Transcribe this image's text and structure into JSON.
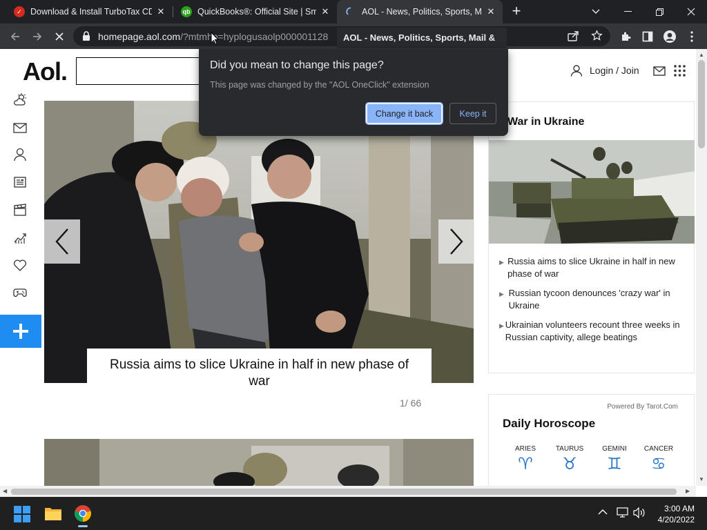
{
  "tabs": [
    {
      "title": "Download & Install TurboTax CD/",
      "favicon": "check-icon",
      "color": "#d52b1e"
    },
    {
      "title": "QuickBooks®: Official Site | Smar",
      "favicon": "qb-icon",
      "color": "#2ca01c"
    },
    {
      "title": "AOL - News, Politics, Sports, Mail",
      "favicon": "loading-spinner-icon",
      "color": "#8ab4f8"
    }
  ],
  "address": {
    "host": "homepage.aol.com",
    "path": "/?mtmhp=hyplogusaolp000001128"
  },
  "tab_tooltip": "AOL - News, Politics, Sports, Mail &",
  "popup": {
    "title": "Did you mean to change this page?",
    "message": "This page was changed by the \"AOL OneClick\" extension",
    "primary": "Change it back",
    "secondary": "Keep it"
  },
  "aol": {
    "logo": "Aol.",
    "login": "Login / Join",
    "sidebar": [
      "weather-icon",
      "mail-icon",
      "user-icon",
      "news-icon",
      "movies-icon",
      "finance-icon",
      "health-icon",
      "games-icon"
    ],
    "slideshow": {
      "caption": "Russia aims to slice Ukraine in half in new phase of war",
      "counter": "1/ 66"
    },
    "ukraine": {
      "heading": "War in Ukraine",
      "items": [
        "Russia aims to slice Ukraine in half in new phase of war",
        "Russian tycoon denounces 'crazy war' in Ukraine",
        "Ukrainian volunteers recount three weeks in Russian captivity, allege beatings"
      ]
    },
    "horoscope": {
      "powered_by": "Powered By Tarot.Com",
      "heading": "Daily Horoscope",
      "signs": [
        {
          "name": "ARIES",
          "glyph": "♈"
        },
        {
          "name": "TAURUS",
          "glyph": "♉"
        },
        {
          "name": "GEMINI",
          "glyph": "♊"
        },
        {
          "name": "CANCER",
          "glyph": "♋"
        }
      ]
    }
  },
  "taskbar": {
    "time": "3:00 AM",
    "date": "4/20/2022"
  }
}
